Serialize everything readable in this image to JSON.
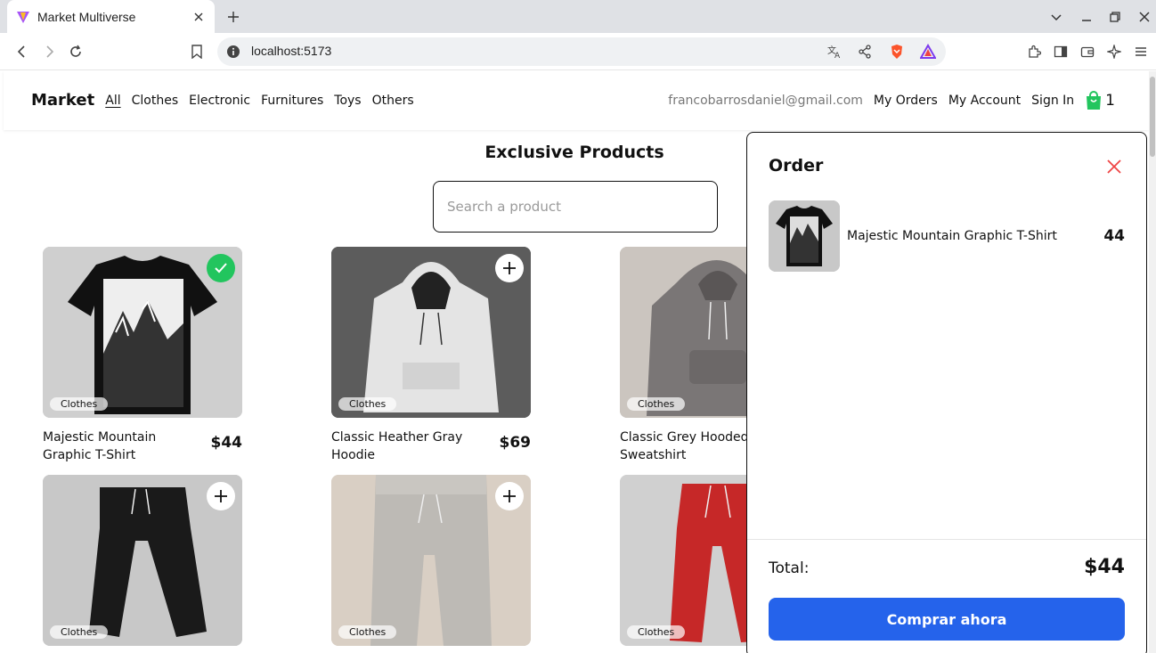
{
  "browser": {
    "tab_title": "Market Multiverse",
    "url": "localhost:5173"
  },
  "nav": {
    "brand": "Market",
    "links": [
      "All",
      "Clothes",
      "Electronic",
      "Furnitures",
      "Toys",
      "Others"
    ],
    "email": "francobarrosdaniel@gmail.com",
    "my_orders": "My Orders",
    "my_account": "My Account",
    "sign_in": "Sign In",
    "cart_count": "1"
  },
  "main": {
    "title": "Exclusive Products",
    "search_placeholder": "Search a product"
  },
  "products": [
    {
      "name": "Majestic Mountain Graphic T-Shirt",
      "price": "$44",
      "category": "Clothes",
      "in_cart": true
    },
    {
      "name": "Classic Heather Gray Hoodie",
      "price": "$69",
      "category": "Clothes",
      "in_cart": false
    },
    {
      "name": "Classic Grey Hooded Sweatshirt",
      "price": "",
      "category": "Clothes",
      "in_cart": false
    },
    {
      "name": "",
      "price": "",
      "category": "Clothes",
      "in_cart": false
    },
    {
      "name": "",
      "price": "",
      "category": "Clothes",
      "in_cart": false
    },
    {
      "name": "",
      "price": "",
      "category": "Clothes",
      "in_cart": false
    }
  ],
  "order": {
    "title": "Order",
    "items": [
      {
        "name": "Majestic Mountain Graphic T-Shirt",
        "price": "44"
      }
    ],
    "total_label": "Total:",
    "total_value": "$44",
    "buy_label": "Comprar ahora"
  },
  "colors": {
    "accent": "#2563eb",
    "check": "#22c55e",
    "close": "#ef4444",
    "cart_icon": "#22c55e"
  }
}
